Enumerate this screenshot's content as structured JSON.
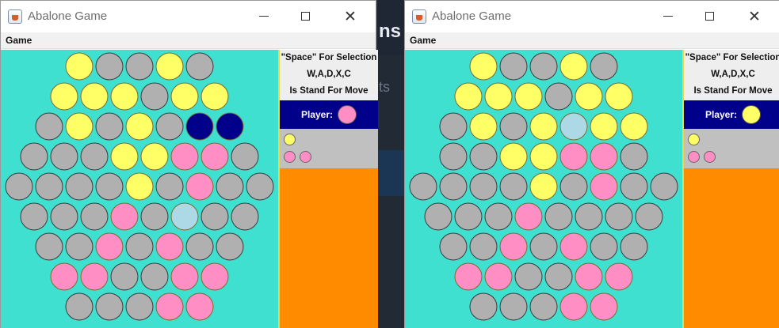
{
  "background": {
    "text1": "ns",
    "text2": "ts"
  },
  "colors": {
    "yellow": "#ffff66",
    "pink": "#ff8ec4",
    "gray": "#b0b0b0",
    "navy": "#00008b",
    "lightblue": "#add8e6",
    "board": "#40e0d0",
    "panel_orange": "#ff8c00"
  },
  "windows": [
    {
      "title": "Abalone Game",
      "icon": "java-cup-icon",
      "menu": "Game",
      "info_lines": [
        "\"Space\" For Selection",
        "W,A,D,X,C",
        "Is Stand For Move"
      ],
      "player_label": "Player:",
      "player_color": "pink",
      "captured": [
        "yellow",
        "pink",
        "pink"
      ],
      "board": [
        "YGGYG",
        "YYYGYY",
        "GYGYGNN",
        "GGGYYPPG",
        "GGGGYGPGG",
        "GGGPGLGG",
        "GGPGPGG",
        "PPGGPP",
        "GGGPP"
      ]
    },
    {
      "title": "Abalone Game",
      "icon": "java-cup-icon",
      "menu": "Game",
      "info_lines": [
        "\"Space\" For Selection",
        "W,A,D,X,C",
        "Is Stand For Move"
      ],
      "player_label": "Player:",
      "player_color": "yellow",
      "captured": [
        "yellow",
        "pink",
        "pink"
      ],
      "board": [
        "YGGYG",
        "YYYGYY",
        "GYGYLYY",
        "GGYYPPG",
        "GGGGYGPGG",
        "GGGPGGGG",
        "GGPGPGG",
        "PPGGPP",
        "GGGPP"
      ]
    }
  ]
}
